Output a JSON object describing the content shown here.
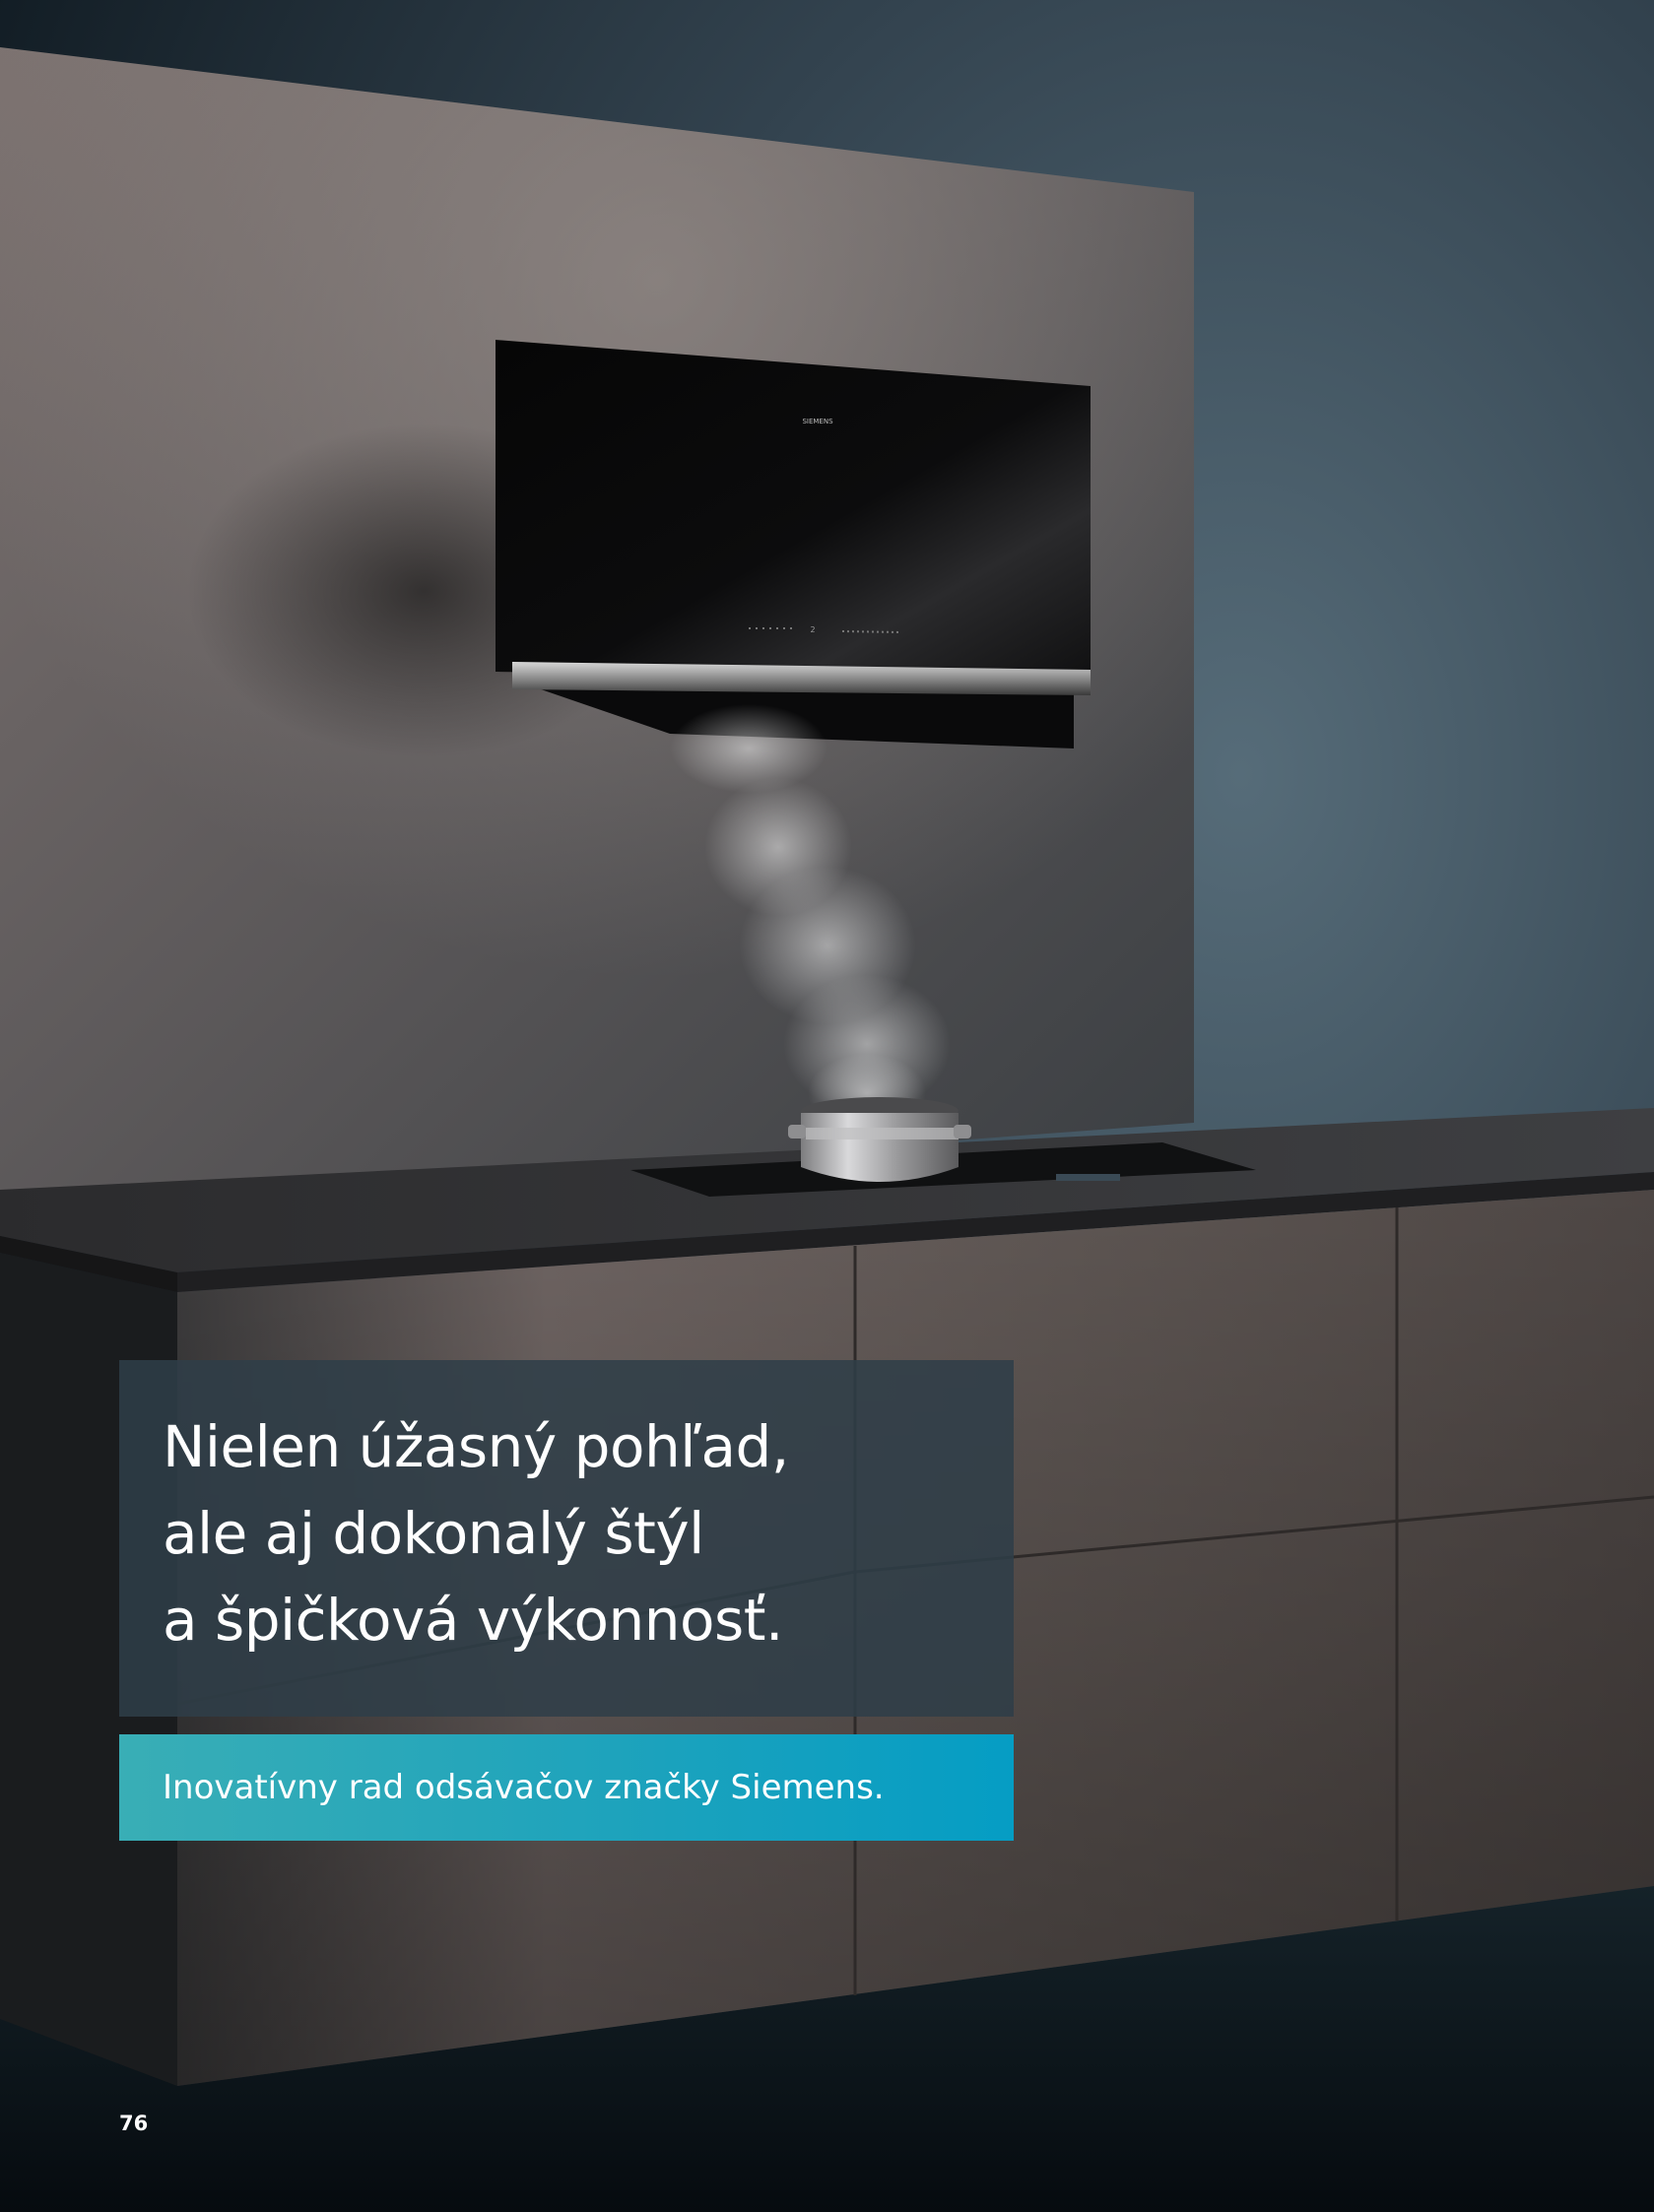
{
  "scene": {
    "hood_brand_label": "SIEMENS",
    "hood_display_digit": "2"
  },
  "headline": {
    "lines": [
      "Nielen úžasný pohľad,",
      "ale aj dokonalý štýl",
      "a špičková výkonnosť."
    ]
  },
  "subline": {
    "text": "Inovatívny rad odsávačov značky Siemens."
  },
  "page_number": "76",
  "colors": {
    "headline_box": "#2f3e48",
    "subline_gradient_start": "#39aeb6",
    "subline_gradient_end": "#059dc4",
    "background": "#0b141b"
  }
}
